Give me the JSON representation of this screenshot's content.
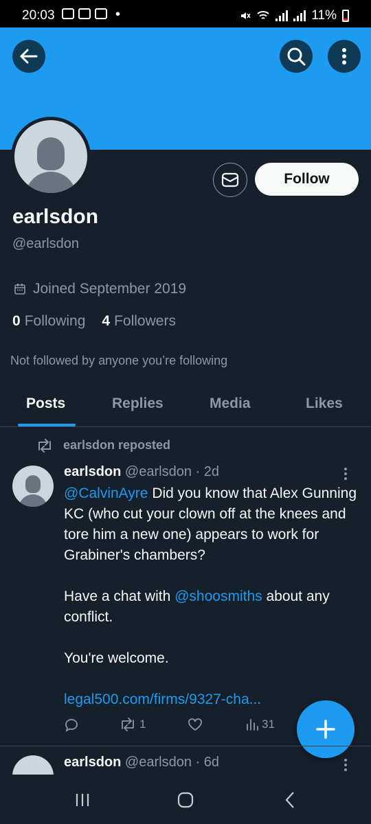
{
  "status_bar": {
    "time": "20:03",
    "dot": "•",
    "battery_text": "11%"
  },
  "header": {
    "back_icon": "arrow-left-icon",
    "search_icon": "search-icon",
    "more_icon": "more-vertical-icon",
    "banner_color": "#1d9bf0"
  },
  "profile": {
    "display_name": "earlsdon",
    "handle": "@earlsdon",
    "joined": "Joined September 2019",
    "following_count": "0",
    "following_label": "Following",
    "followers_count": "4",
    "followers_label": "Followers",
    "not_followed": "Not followed by anyone you’re following",
    "follow_label": "Follow",
    "message_icon": "envelope-icon"
  },
  "tabs": [
    {
      "label": "Posts",
      "active": true
    },
    {
      "label": "Replies",
      "active": false
    },
    {
      "label": "Media",
      "active": false
    },
    {
      "label": "Likes",
      "active": false
    }
  ],
  "tweet1": {
    "repost_text": "earlsdon reposted",
    "name": "earlsdon",
    "handle_time": "@earlsdon · 2d",
    "mention1": "@CalvinAyre",
    "line1": " Did you know that Alex Gunning KC (who cut your clown off at the knees and tore him a new one) appears to work for Grabiner's chambers?",
    "line2_pre": "Have a chat with ",
    "mention2": "@shoosmiths",
    "line2_post": " about any conflict.",
    "line3": "You're welcome.",
    "link": "legal500.com/firms/9327-cha...",
    "reply_count": "",
    "retweet_count": "1",
    "like_count": "",
    "views_count": "31"
  },
  "tweet2": {
    "name": "earlsdon",
    "handle_time": "@earlsdon · 6d"
  },
  "accent_color": "#1d9bf0",
  "background_color": "#15202b"
}
